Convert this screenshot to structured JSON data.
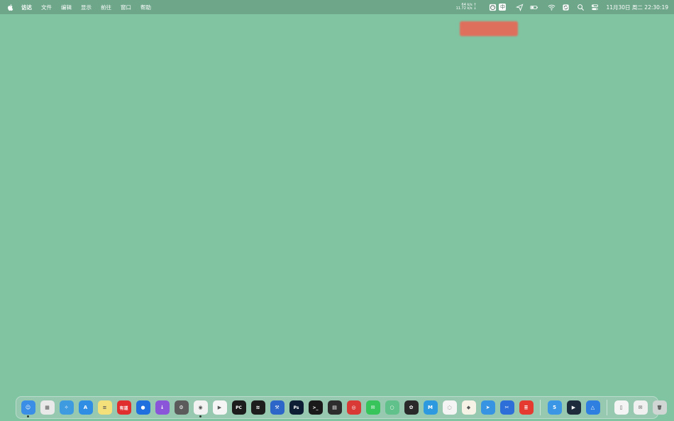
{
  "menubar": {
    "items": [
      "访达",
      "文件",
      "编辑",
      "显示",
      "前往",
      "窗口",
      "帮助"
    ],
    "net_up": "64 k/s ↑",
    "net_down": "11.72 k/s ↓",
    "ime": "中",
    "clock": "11月30日 周二  22:30:19"
  },
  "dock": {
    "apps": [
      {
        "name": "finder",
        "bg": "#3a8ee6",
        "glyph": "☺",
        "running": true
      },
      {
        "name": "launchpad",
        "bg": "#e9e9e9",
        "glyph": "▦"
      },
      {
        "name": "safari",
        "bg": "#3f9be0",
        "glyph": "✧"
      },
      {
        "name": "app-store",
        "bg": "#2f8de4",
        "glyph": "A"
      },
      {
        "name": "notes",
        "bg": "#f4e07a",
        "glyph": "≡"
      },
      {
        "name": "youdao",
        "bg": "#e02d2d",
        "glyph": "有道"
      },
      {
        "name": "maps-pin",
        "bg": "#1f6fde",
        "glyph": "●"
      },
      {
        "name": "downie",
        "bg": "#8a55d8",
        "glyph": "↓"
      },
      {
        "name": "system-preferences",
        "bg": "#5b5b5b",
        "glyph": "⚙"
      },
      {
        "name": "chrome",
        "bg": "#f2f2f2",
        "glyph": "◉",
        "running": true
      },
      {
        "name": "infuse",
        "bg": "#f5f5f5",
        "glyph": "▶"
      },
      {
        "name": "pycharm",
        "bg": "#1c1c1c",
        "glyph": "PC"
      },
      {
        "name": "spotify",
        "bg": "#1d1d1d",
        "glyph": "≋"
      },
      {
        "name": "xcode",
        "bg": "#2c66c9",
        "glyph": "⚒"
      },
      {
        "name": "photoshop",
        "bg": "#0d1d33",
        "glyph": "Ps"
      },
      {
        "name": "terminal",
        "bg": "#1a1a1a",
        "glyph": ">_"
      },
      {
        "name": "final-cut",
        "bg": "#2d2d2d",
        "glyph": "▤"
      },
      {
        "name": "netease-music",
        "bg": "#d93a36",
        "glyph": "◎"
      },
      {
        "name": "wechat",
        "bg": "#37c45b",
        "glyph": "✉"
      },
      {
        "name": "loop",
        "bg": "#60c28a",
        "glyph": "○"
      },
      {
        "name": "tes",
        "bg": "#2a2a2a",
        "glyph": "✿"
      },
      {
        "name": "markdown",
        "bg": "#2d9ae0",
        "glyph": "M"
      },
      {
        "name": "chat",
        "bg": "#f4f4f4",
        "glyph": "◌"
      },
      {
        "name": "sketch",
        "bg": "#f7f2e6",
        "glyph": "◆"
      },
      {
        "name": "paste",
        "bg": "#3794e3",
        "glyph": "➤"
      },
      {
        "name": "utility",
        "bg": "#2d6ed8",
        "glyph": "✂"
      },
      {
        "name": "iqiyi",
        "bg": "#e43a2f",
        "glyph": "≣"
      },
      {
        "name": "sep1",
        "separator": true
      },
      {
        "name": "five",
        "bg": "#3b96e6",
        "glyph": "5"
      },
      {
        "name": "video",
        "bg": "#1e2b3d",
        "glyph": "▶"
      },
      {
        "name": "instruments",
        "bg": "#2e7fe0",
        "glyph": "△"
      },
      {
        "name": "sep2",
        "separator": true
      },
      {
        "name": "document",
        "bg": "#f4f4f4",
        "glyph": "▯"
      },
      {
        "name": "envelope",
        "bg": "#f0f0f0",
        "glyph": "✉"
      },
      {
        "name": "trash",
        "bg": "#cfd6d3",
        "glyph": "🗑"
      }
    ]
  }
}
